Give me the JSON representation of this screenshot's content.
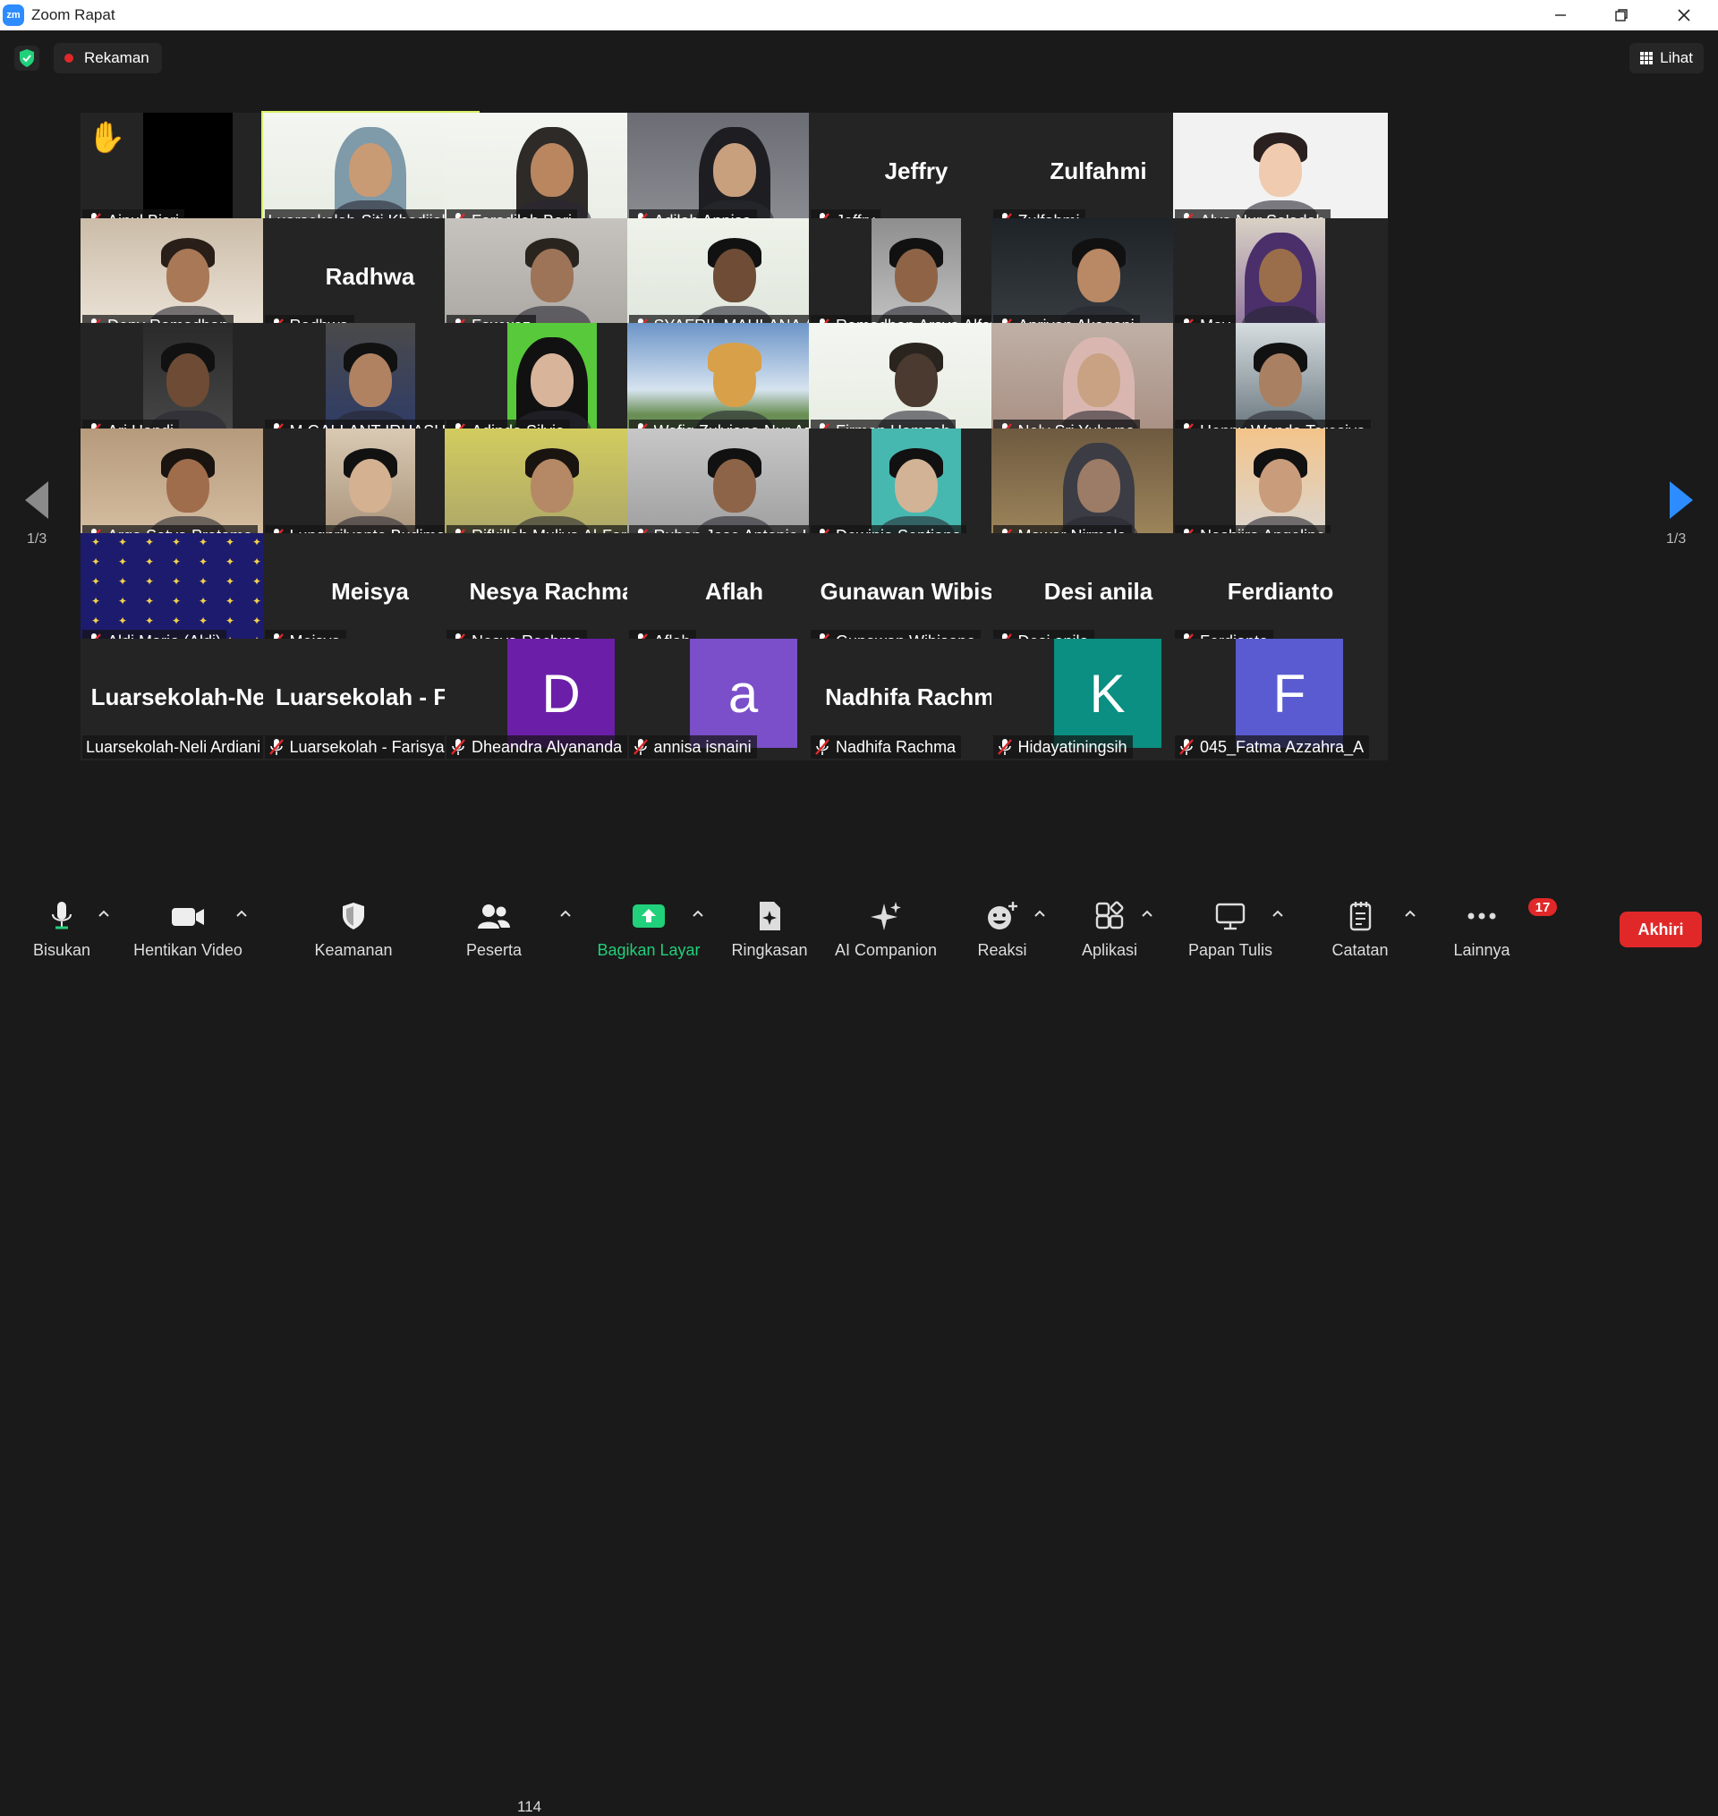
{
  "window": {
    "app_title": "Zoom Rapat",
    "logo_text": "zm"
  },
  "topbar": {
    "recording_label": "Rekaman",
    "view_label": "Lihat"
  },
  "pagination": {
    "left": "1/3",
    "right": "1/3"
  },
  "tiles": [
    {
      "name": "Ainul Bisri",
      "mode": "video",
      "muted": true,
      "raised_hand": true
    },
    {
      "name": "Luarsekolah-Siti Khodijah",
      "mode": "video",
      "muted": false,
      "active_speaker": true
    },
    {
      "name": "Faradilah Bari",
      "mode": "video",
      "muted": true
    },
    {
      "name": "Adilah Annisa",
      "mode": "video",
      "muted": true
    },
    {
      "name": "Jeffry",
      "mode": "name",
      "display": "Jeffry",
      "muted": true
    },
    {
      "name": "Zulfahmi",
      "mode": "name",
      "display": "Zulfahmi",
      "muted": true
    },
    {
      "name": "Alya Nur Sa'adah",
      "mode": "video",
      "muted": true
    },
    {
      "name": "Deny Ramadhan",
      "mode": "video",
      "muted": true
    },
    {
      "name": "Radhwa",
      "mode": "name",
      "display": "Radhwa",
      "muted": true
    },
    {
      "name": "Fawwaz",
      "mode": "video",
      "muted": true
    },
    {
      "name": "SYAFRIL MAULANA AF...",
      "mode": "video",
      "muted": true
    },
    {
      "name": "Ramadhan Arsya Alfath",
      "mode": "video",
      "muted": true
    },
    {
      "name": "Apriyan Akagani",
      "mode": "video",
      "muted": true
    },
    {
      "name": "May",
      "mode": "video",
      "muted": true
    },
    {
      "name": "Ari Handi",
      "mode": "video",
      "muted": true
    },
    {
      "name": "M GALLANT IRHASH A",
      "mode": "video",
      "muted": true
    },
    {
      "name": "Adinda Silvia",
      "mode": "video",
      "muted": true
    },
    {
      "name": "Wafiq Zulviana Nur Az...",
      "mode": "video",
      "muted": true
    },
    {
      "name": "Firman Hamzah",
      "mode": "video",
      "muted": true
    },
    {
      "name": "Nely Sri Yulvyna",
      "mode": "video",
      "muted": true
    },
    {
      "name": "Henny Wanda Teresiya",
      "mode": "video",
      "muted": true
    },
    {
      "name": "Arga Satya Pratama",
      "mode": "video",
      "muted": true
    },
    {
      "name": "Lungprilyanto Budiman",
      "mode": "video",
      "muted": true
    },
    {
      "name": "Rifkillah Muliya Al-Fari...",
      "mode": "video",
      "muted": true
    },
    {
      "name": "Ruben Jose Antonio Le...",
      "mode": "video",
      "muted": true
    },
    {
      "name": "Dewinia Septiana",
      "mode": "video",
      "muted": true
    },
    {
      "name": "Mawar Nirmala",
      "mode": "video",
      "muted": true
    },
    {
      "name": "Nashiira Angeline",
      "mode": "video",
      "muted": true
    },
    {
      "name": "Aldi Mario (Aldi)",
      "mode": "video",
      "muted": true
    },
    {
      "name": "Meisya",
      "mode": "name",
      "display": "Meisya",
      "muted": true
    },
    {
      "name": "Nesya Rachma",
      "mode": "name",
      "display": "Nesya Rachma",
      "muted": true
    },
    {
      "name": "Aflah",
      "mode": "name",
      "display": "Aflah",
      "muted": true
    },
    {
      "name": "Gunawan Wibisono",
      "mode": "name",
      "display": "Gunawan  Wibis...",
      "muted": true
    },
    {
      "name": "Desi anila",
      "mode": "name",
      "display": "Desi anila",
      "muted": true
    },
    {
      "name": "Ferdianto",
      "mode": "name",
      "display": "Ferdianto",
      "muted": true
    },
    {
      "name": "Luarsekolah-Neli Ardiani",
      "mode": "name",
      "display": "Luarsekolah-Ne...",
      "muted": false
    },
    {
      "name": "Luarsekolah - Farisya ...",
      "mode": "name",
      "display": "Luarsekolah  - F...",
      "muted": true
    },
    {
      "name": "Dheandra Alyananda",
      "mode": "avatar",
      "letter": "D",
      "avatar_color": "#6b1fa8",
      "muted": true
    },
    {
      "name": "annisa isnaini",
      "mode": "avatar",
      "letter": "a",
      "avatar_color": "#7a4fc9",
      "muted": true
    },
    {
      "name": "Nadhifa Rachma",
      "mode": "name",
      "display": "Nadhifa Rachma",
      "muted": true
    },
    {
      "name": "Hidayatiningsih",
      "mode": "avatar",
      "letter": "K",
      "avatar_color": "#0a8f82",
      "muted": true
    },
    {
      "name": "045_Fatma Azzahra_A",
      "mode": "avatar",
      "letter": "F",
      "avatar_color": "#5a5bd0",
      "muted": true
    }
  ],
  "toolbar": {
    "mute_label": "Bisukan",
    "video_label": "Hentikan Video",
    "security_label": "Keamanan",
    "participants_label": "Peserta",
    "participants_count": "114",
    "share_label": "Bagikan Layar",
    "summary_label": "Ringkasan",
    "ai_label": "AI Companion",
    "reactions_label": "Reaksi",
    "apps_label": "Aplikasi",
    "whiteboard_label": "Papan Tulis",
    "notes_label": "Catatan",
    "more_label": "Lainnya",
    "more_badge": "17",
    "end_label": "Akhiri"
  },
  "colors": {
    "accent_green": "#21d07a",
    "end_red": "#e02828",
    "active_speaker": "#d7f169",
    "zoom_blue": "#2d8cff"
  }
}
